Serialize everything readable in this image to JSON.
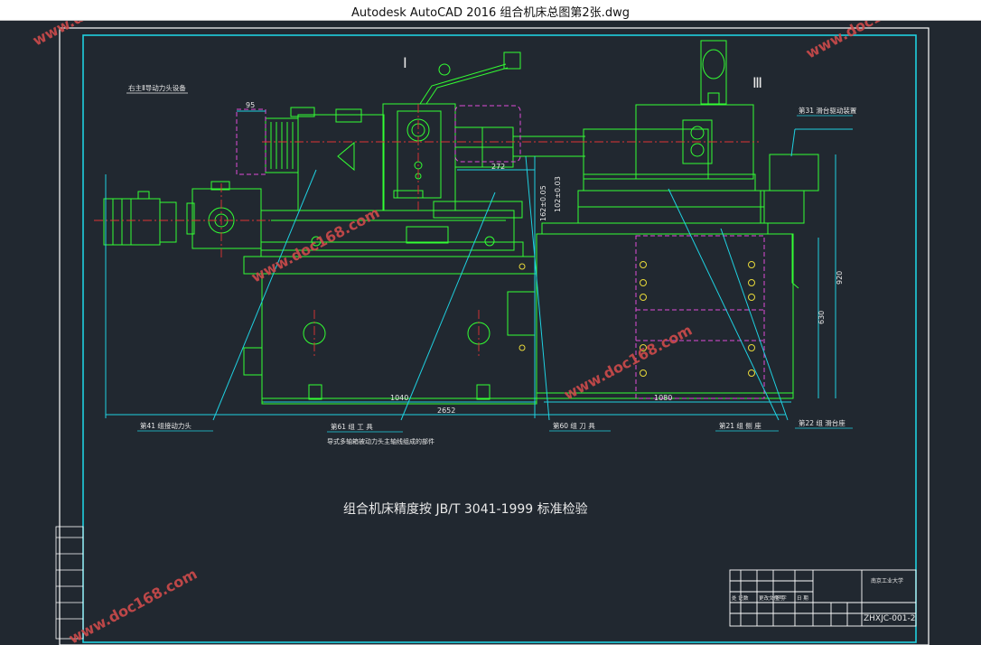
{
  "window": {
    "title": "Autodesk AutoCAD 2016     组合机床总图第2张.dwg"
  },
  "colors": {
    "background": "#212830",
    "frame": "#ffffff",
    "border": "#1fd0e0",
    "machine": "#33ff33",
    "hidden": "#e04bd8",
    "centerline": "#e03434",
    "label_text": "#e8e8e8",
    "watermark": "#ce4b4b"
  },
  "drawing": {
    "roman_1": "Ⅰ",
    "roman_3": "Ⅲ",
    "note_top": "右主Ⅱ导动力头设备",
    "dims": {
      "d95": "95",
      "d272": "272",
      "d162": "162±0.05",
      "d102": "102±0.03",
      "d920": "920",
      "d630": "630",
      "d1040": "1040",
      "d1080": "1080",
      "d2652": "2652"
    },
    "callouts": {
      "c31": "第31 滑台驱动装置",
      "c41": "第41 组接动力头",
      "c61": "第61 组 工 具",
      "c61_sub": "导式多轴箱被动力头主轴线组成的部件",
      "c60": "第60 组 刀 具",
      "c21": "第21 组 侧 座",
      "c22": "第22 组 滑台座"
    },
    "standard_note": "组合机床精度按 JB/T 3041-1999 标准检验",
    "drawing_no": "ZHXJC-001-2",
    "company": "南京工业大学",
    "title_block_rows": [
      "处 记",
      "数",
      "更改文件号",
      "签 字",
      "日 期"
    ]
  },
  "watermark": {
    "text": "www.doc168.com"
  }
}
